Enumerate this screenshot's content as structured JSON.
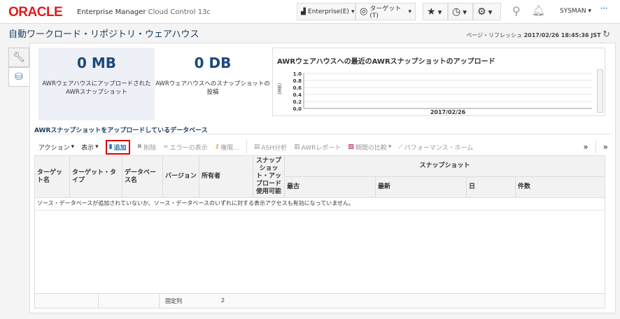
{
  "header": {
    "logo": "ORACLE",
    "product": "Enterprise Manager",
    "product_sub": "Cloud Control 13c",
    "enterprise_menu": "Enterprise(E)",
    "target_menu": "ターゲット(T)",
    "user": "SYSMAN"
  },
  "page": {
    "title": "自動ワークロード・リポジトリ・ウェアハウス",
    "refresh_label": "ページ・リフレッシュ",
    "refresh_time": "2017/02/26 18:45:36 JST"
  },
  "stats": [
    {
      "value": "0 MB",
      "label": "AWRウェアハウスにアップロードされたAWRスナップショット"
    },
    {
      "value": "0 DB",
      "label": "AWRウェアハウスへのスナップショットの投稿"
    }
  ],
  "chart_data": {
    "type": "line",
    "title": "AWRウェアハウスへの最近のAWRスナップショットのアップロード",
    "ylabel": "(MB)",
    "xlabel": "",
    "ylim": [
      0,
      1.0
    ],
    "yticks": [
      "1.0",
      "0.8",
      "0.6",
      "0.4",
      "0.2",
      "0.0"
    ],
    "categories": [
      "2017/02/26"
    ],
    "series": []
  },
  "section": {
    "title": "AWRスナップショットをアップロードしているデータベース"
  },
  "toolbar": {
    "actions": "アクション",
    "view": "表示",
    "add": "追加",
    "delete": "削除",
    "show_errors": "エラーの表示",
    "privileges": "権限...",
    "ash": "ASH分析",
    "awr_report": "AWRレポート",
    "compare": "期間の比較",
    "perf_home": "パフォーマンス・ホーム",
    "more": "»"
  },
  "table": {
    "columns": [
      "ターゲット名",
      "ターゲット・タイプ",
      "データベース名",
      "バージョン",
      "所有者",
      "スナップショット・アップロード使用可能"
    ],
    "group": "スナップショット",
    "subcolumns": [
      "最古",
      "最新",
      "日",
      "件数"
    ],
    "empty": "ソース・データベースが追加されていないか、ソース・データベースのいずれに対する表示アクセスも有効になっていません。"
  },
  "footer": {
    "frozen_label": "固定列",
    "frozen_value": "2"
  }
}
